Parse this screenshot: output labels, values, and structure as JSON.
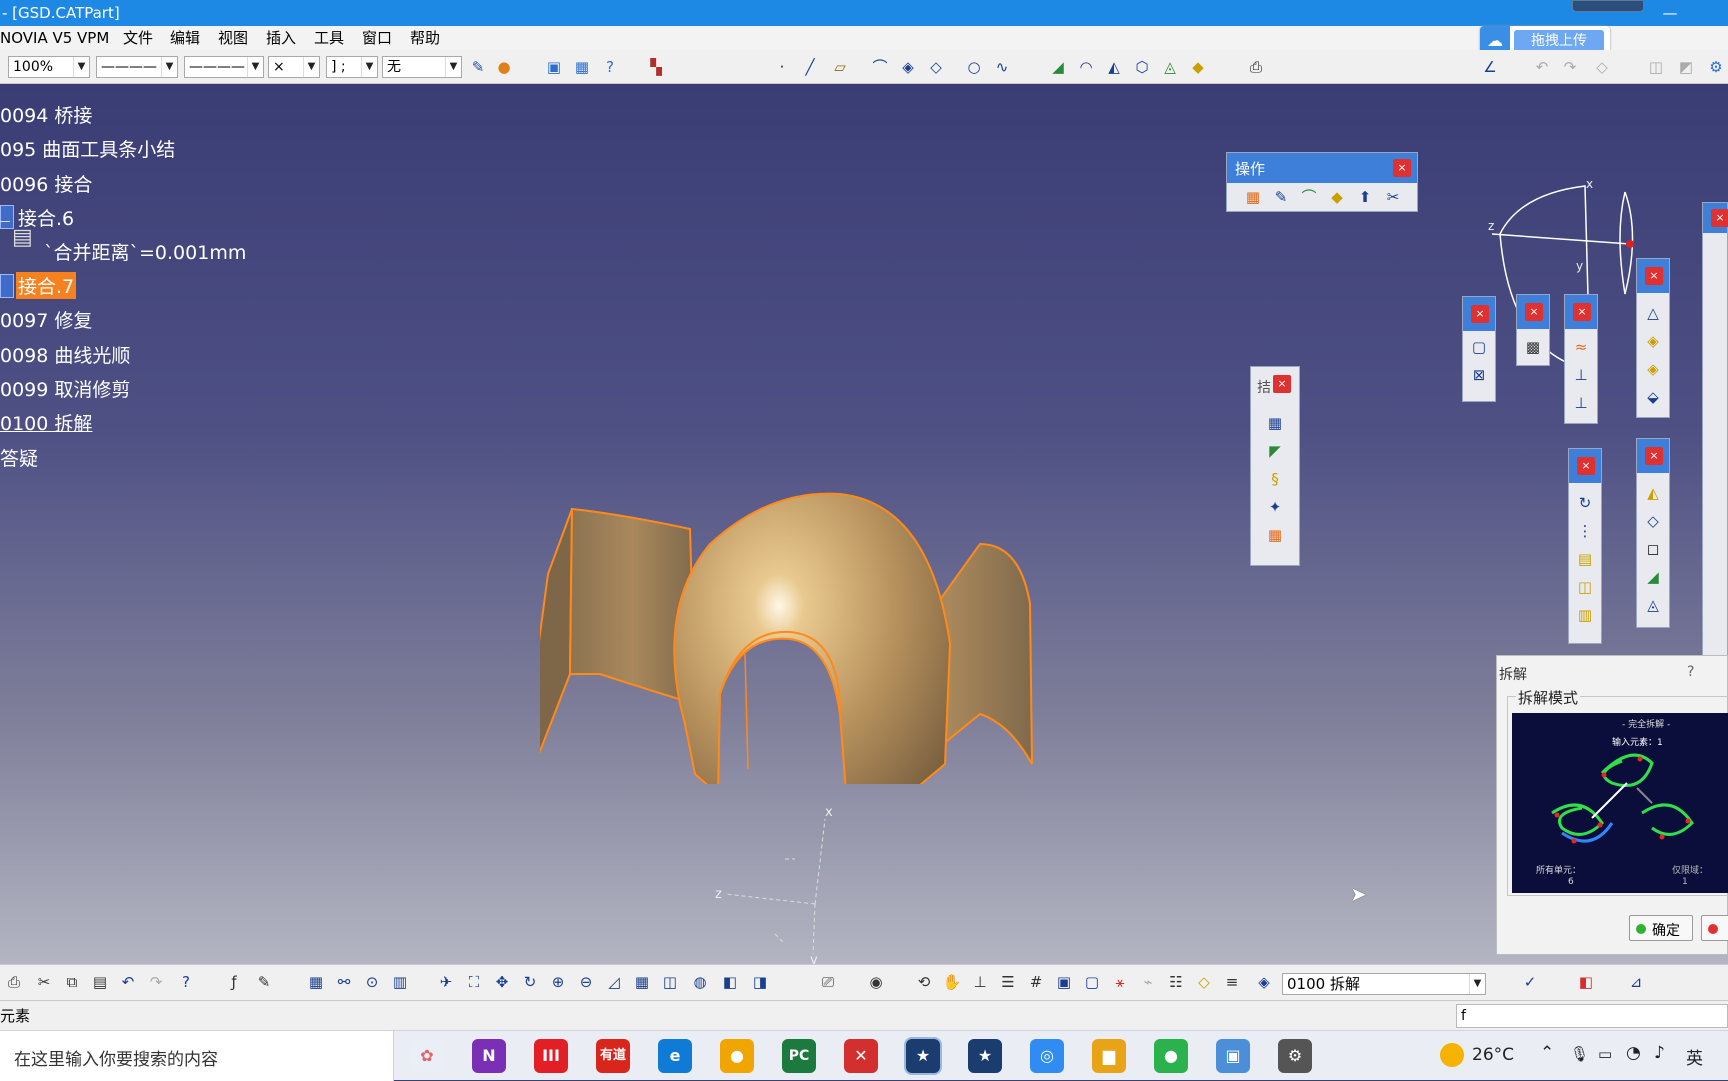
{
  "window": {
    "title": "- [GSD.CATPart]",
    "minimize": "—",
    "maximize": "□"
  },
  "upload_widget": {
    "label": "拖拽上传",
    "icon": "cloud-icon"
  },
  "menu": [
    "NOVIA V5 VPM",
    "文件",
    "编辑",
    "视图",
    "插入",
    "工具",
    "窗口",
    "帮助"
  ],
  "toolbar": {
    "zoom": "100%",
    "line_type": "————",
    "line_weight": "————",
    "point_style": "×",
    "layer_prefix": "] ;",
    "layer": "无"
  },
  "tree": [
    {
      "label": "0094 桥接"
    },
    {
      "label": "095 曲面工具条小结"
    },
    {
      "label": "0096 接合"
    },
    {
      "label": "接合.6"
    },
    {
      "label": "`合并距离`=0.001mm"
    },
    {
      "label": "接合.7"
    },
    {
      "label": "0097 修复"
    },
    {
      "label": "0098 曲线光顺"
    },
    {
      "label": "0099 取消修剪"
    },
    {
      "label": "0100 拆解"
    },
    {
      "label": "答疑"
    }
  ],
  "operation_toolbar": {
    "title": "操作",
    "close": "×"
  },
  "small_toolbar": {
    "title": "拮",
    "close": "×"
  },
  "compass": {
    "x": "x",
    "y": "y",
    "z": "z"
  },
  "axis_model": {
    "x": "x",
    "y": "y",
    "z": "z"
  },
  "disassemble_panel": {
    "title": "拆解",
    "help": "?",
    "group_label": "拆解模式",
    "mode_caption": "- 完全拆解 -",
    "input_label": "输入元素：1",
    "all_cells_label": "所有单元：",
    "all_cells_value": "6",
    "domains_label": "仅限域：",
    "domains_value": "1",
    "ok_label": "确定"
  },
  "bottom_toolbar": {
    "workbench": "0100 拆解"
  },
  "status": {
    "left": "元素",
    "command": "f"
  },
  "taskbar": {
    "search_placeholder": "在这里输入你要搜索的内容",
    "temperature": "26°C",
    "ime": "英",
    "apps": [
      "N",
      "III",
      "有道",
      "e",
      "●",
      "PC",
      "✕",
      "★",
      "★",
      "◎",
      "▆",
      "●",
      "▣",
      "⚙"
    ],
    "app_colors": [
      "#7b2fb5",
      "#e21f26",
      "#d9261c",
      "#0f7bd6",
      "#f0a500",
      "#1c7a3e",
      "#d32f2f",
      "#1a3c6e",
      "#1a3c6e",
      "#2f8cf2",
      "#e8a317",
      "#2bb24c",
      "#4a8fd8",
      "#555555"
    ]
  }
}
